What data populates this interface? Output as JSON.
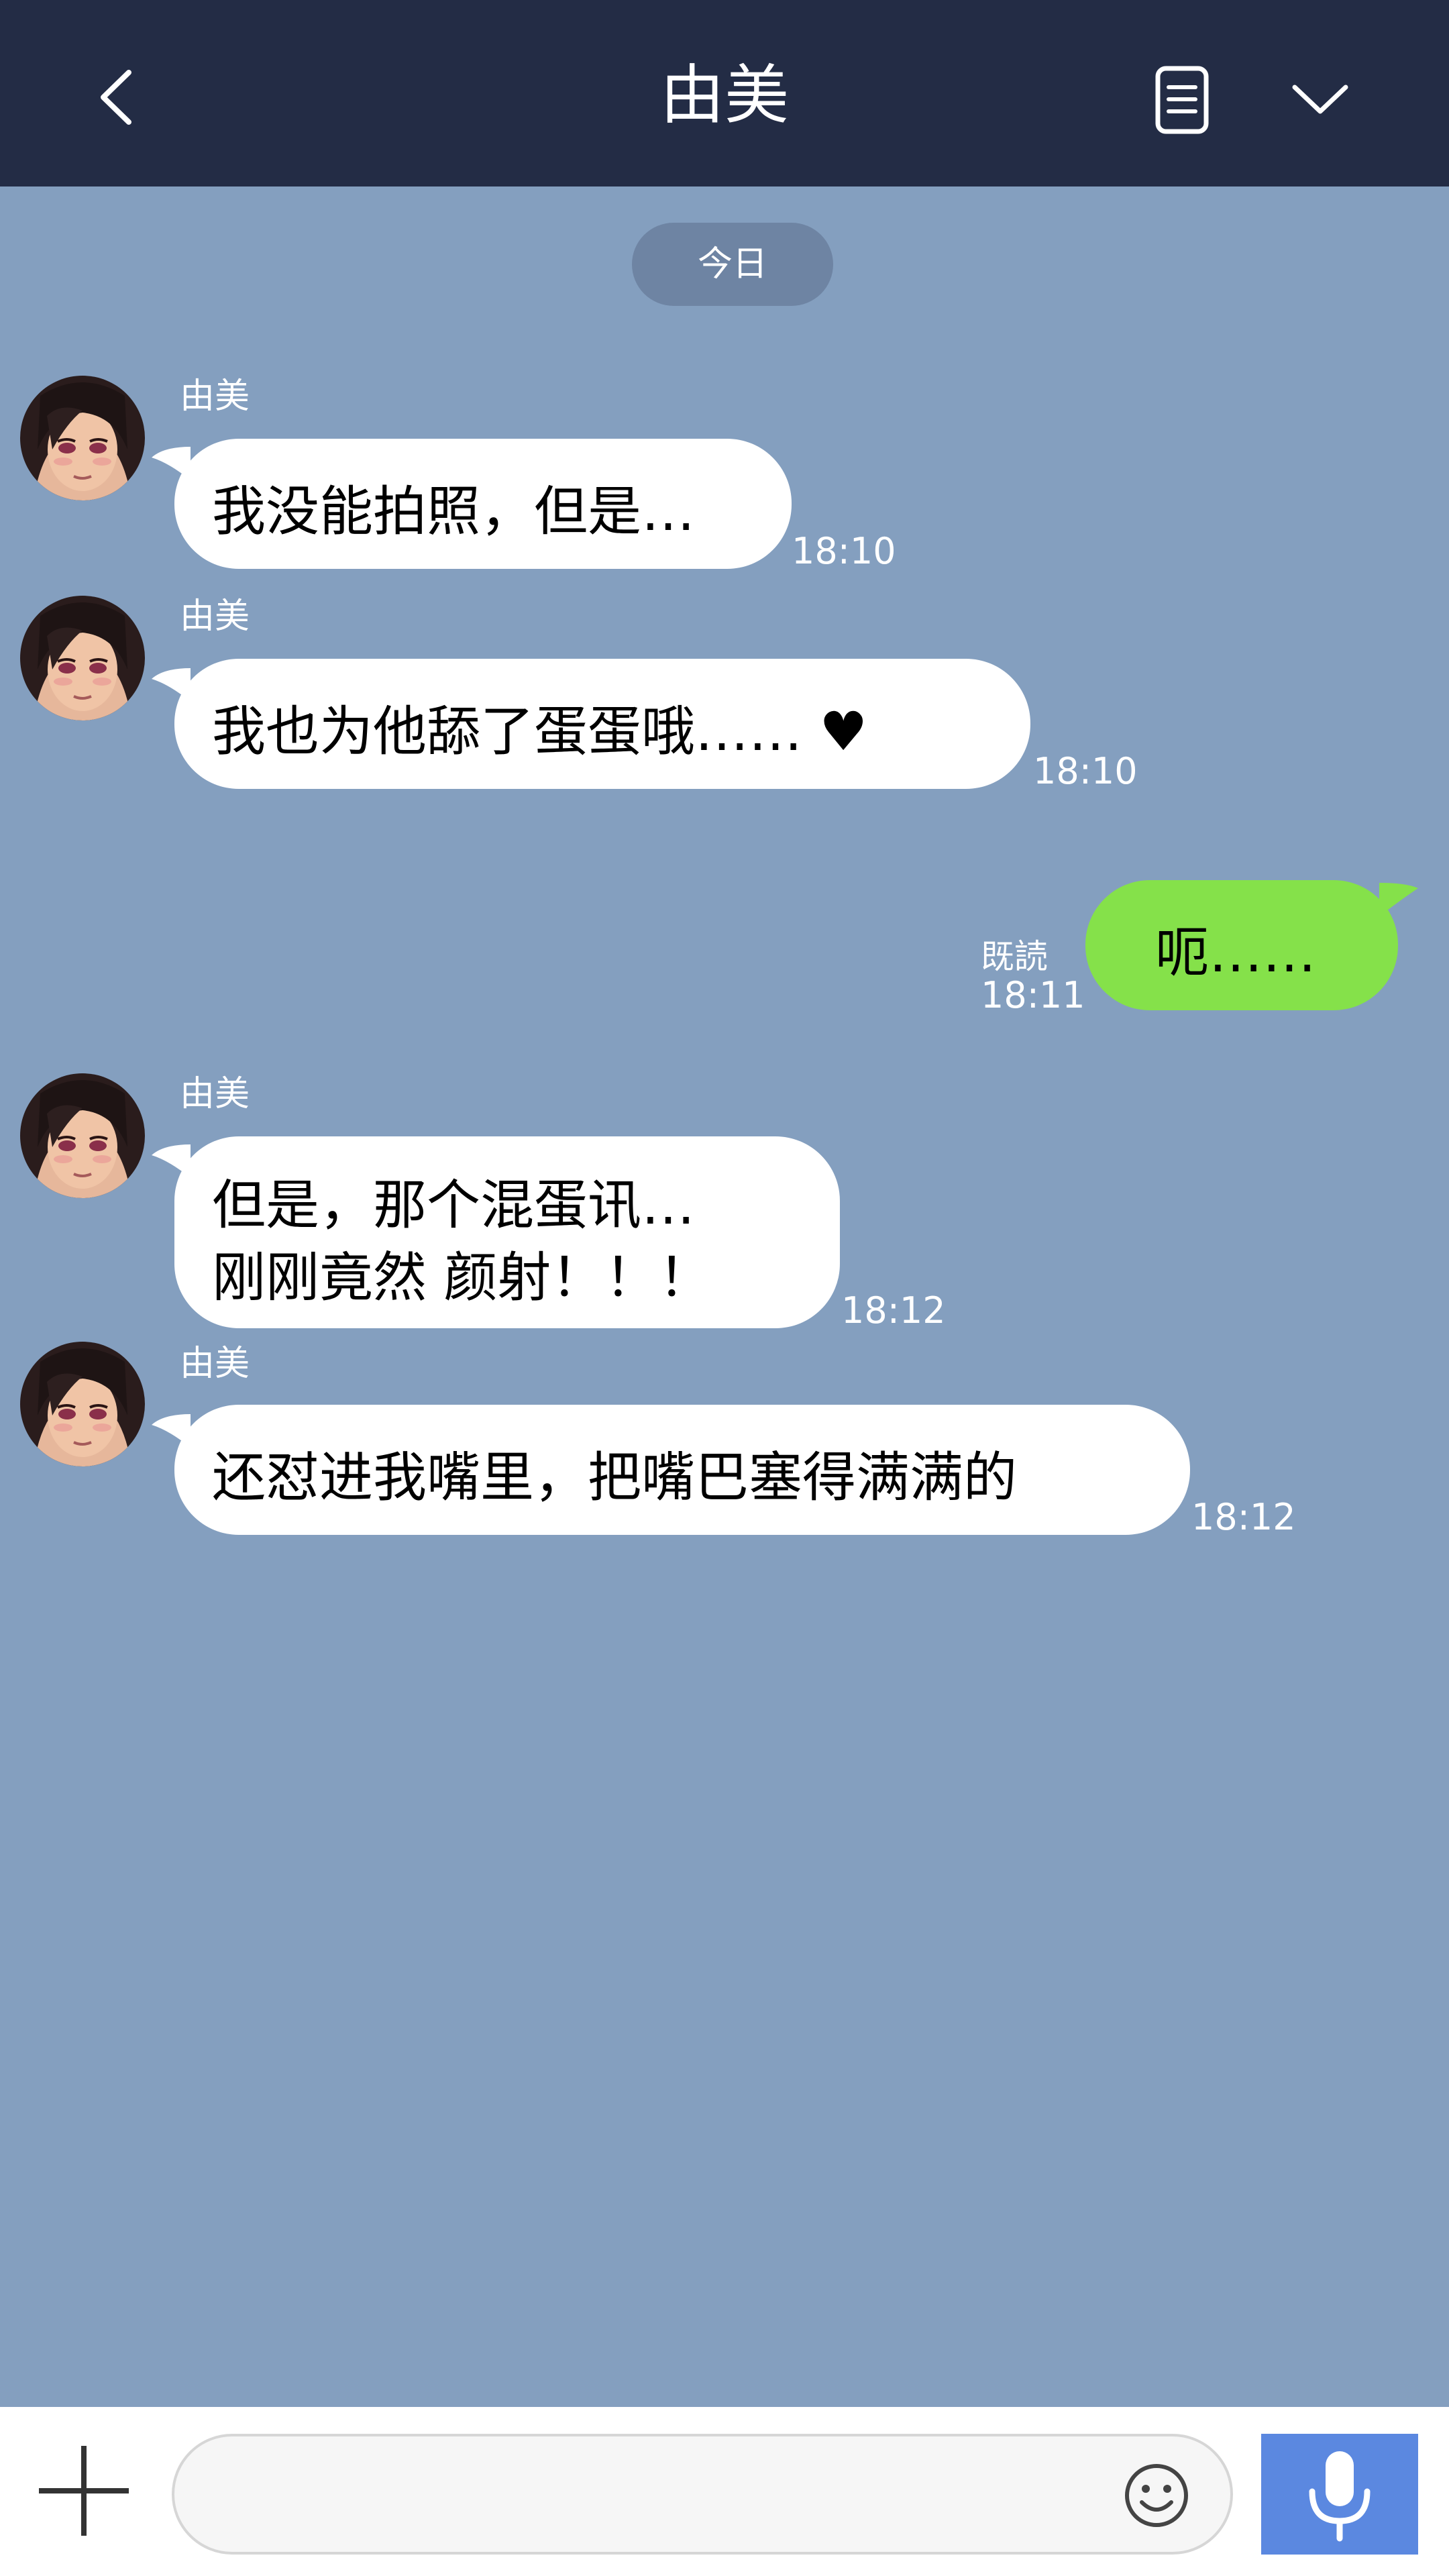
{
  "header": {
    "title": "由美",
    "icons": [
      "back-chevron-icon",
      "notes-icon",
      "chevron-down-icon"
    ]
  },
  "date_separator": "今日",
  "messages": [
    {
      "sender": "由美",
      "text": "我没能拍照，但是…",
      "time": "18:10"
    },
    {
      "sender": "由美",
      "text": "我也为他舔了蛋蛋哦…… ♥",
      "time": "18:10"
    },
    {
      "sender": "me",
      "text": "呃……",
      "read_label": "既読",
      "time": "18:11"
    },
    {
      "sender": "由美",
      "line1": "但是，那个混蛋讯…",
      "line2": "刚刚竟然 颜射！！！",
      "time": "18:12"
    },
    {
      "sender": "由美",
      "text": "还怼进我嘴里，把嘴巴塞得满满的",
      "time": "18:12"
    }
  ],
  "footer": {
    "input_placeholder": "",
    "icons": [
      "plus-icon",
      "smiley-icon",
      "microphone-icon"
    ]
  },
  "colors": {
    "header_bg": "#232c45",
    "chat_bg": "#849fbf",
    "incoming_bubble": "#ffffff",
    "outgoing_bubble": "#85e14a",
    "mic_button": "#5b88e0"
  }
}
